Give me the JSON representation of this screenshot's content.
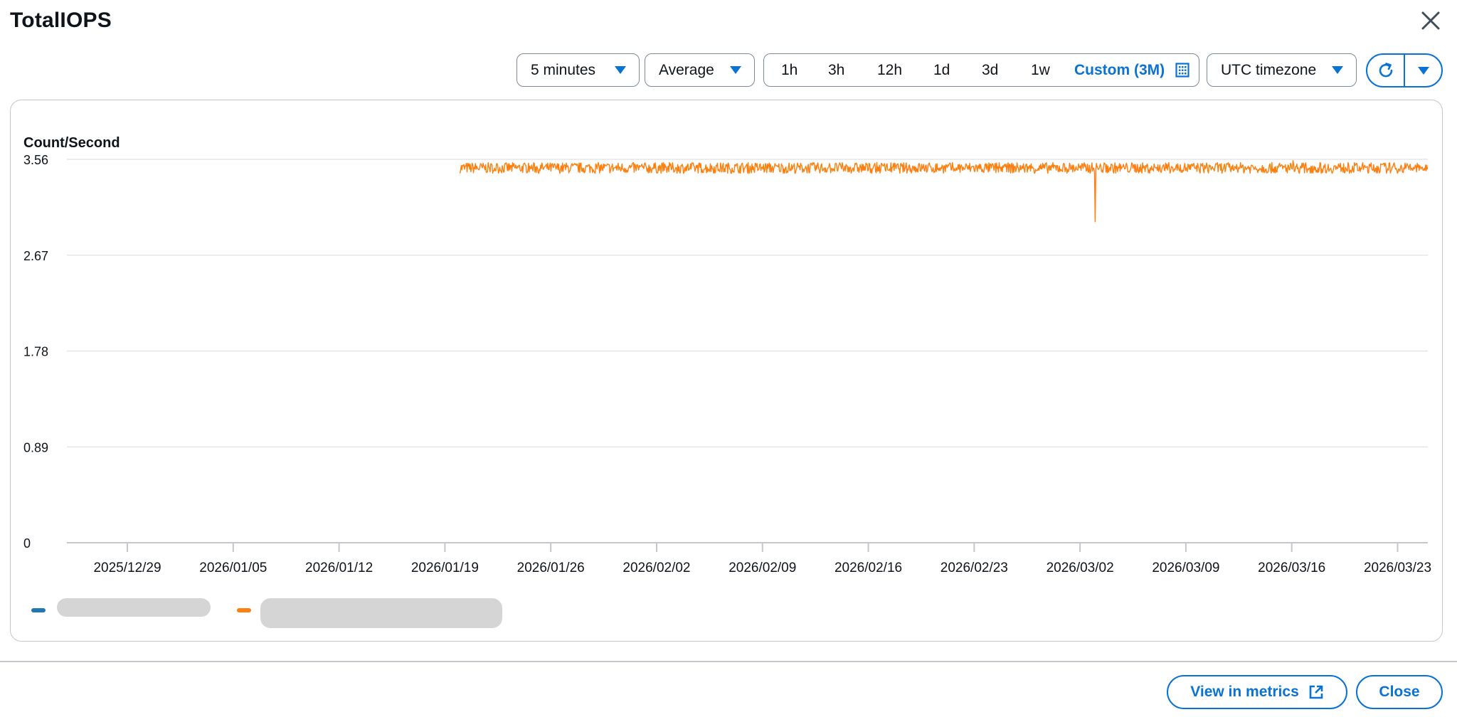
{
  "dialog": {
    "title": "TotalIOPS",
    "close_icon": "close-icon"
  },
  "toolbar": {
    "period": {
      "value": "5 minutes",
      "icon": "caret-down-icon"
    },
    "statistic": {
      "value": "Average",
      "icon": "caret-down-icon"
    },
    "ranges": [
      "1h",
      "3h",
      "12h",
      "1d",
      "3d",
      "1w"
    ],
    "custom_range": {
      "label": "Custom (3M)",
      "icon": "calendar-icon"
    },
    "timezone": {
      "value": "UTC timezone",
      "icon": "caret-down-icon"
    },
    "refresh": {
      "icon": "refresh-icon",
      "menu_icon": "caret-down-icon"
    }
  },
  "chart_data": {
    "type": "line",
    "ylabel": "Count/Second",
    "ylim": [
      0,
      3.56
    ],
    "y_ticks": [
      "3.56",
      "2.67",
      "1.78",
      "0.89",
      "0"
    ],
    "x_ticks": [
      "2025/12/29",
      "2026/01/05",
      "2026/01/12",
      "2026/01/19",
      "2026/01/26",
      "2026/02/02",
      "2026/02/09",
      "2026/02/16",
      "2026/02/23",
      "2026/03/02",
      "2026/03/09",
      "2026/03/16",
      "2026/03/23"
    ],
    "xlim": [
      "2025/12/25",
      "2026/03/25"
    ],
    "grid": true,
    "series": [
      {
        "color": "#1f77b4",
        "values": []
      },
      {
        "color": "#ff7f0e",
        "start": "2026/01/20",
        "end": "2026/03/25",
        "typical_value": 3.48,
        "min_value": 3.48,
        "max_value": 3.49,
        "notable_dip": {
          "x": "2026/03/03",
          "y": 2.98
        }
      }
    ]
  },
  "legend": {
    "items": [
      {
        "color": "#1f77b4"
      },
      {
        "color": "#ff7f0e"
      }
    ]
  },
  "footer": {
    "view_in_metrics": "View in metrics",
    "external_icon": "external-link-icon",
    "close": "Close"
  }
}
